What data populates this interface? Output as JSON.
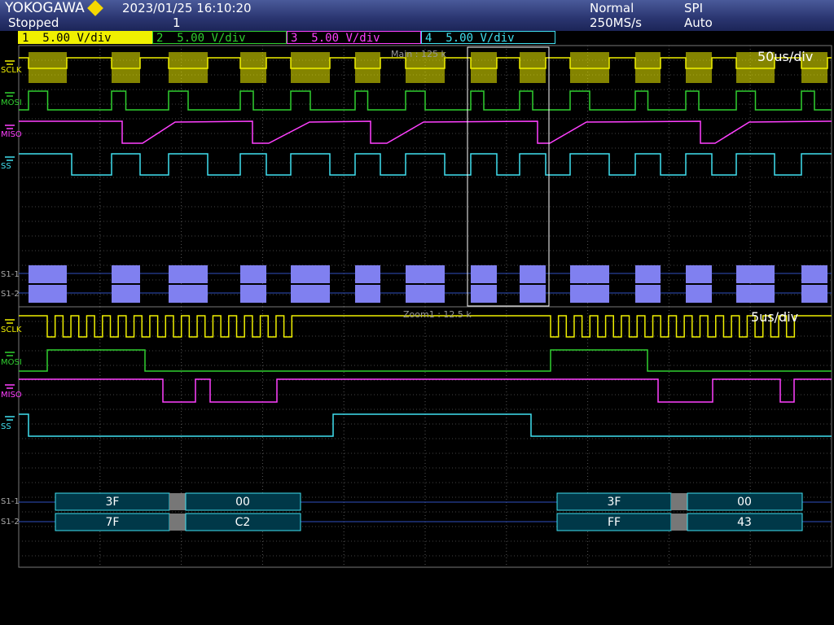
{
  "header": {
    "brand": "YOKOGAWA",
    "status": "Stopped",
    "datetime": "2023/01/25 16:10:20",
    "acq_count": "1",
    "trigger_mode": "Normal",
    "sample_rate": "250MS/s",
    "trigger_type": "SPI",
    "trigger_setting": "Auto"
  },
  "channels": [
    {
      "num": "1",
      "scale": "5.00 V/div",
      "color": "#f0f000"
    },
    {
      "num": "2",
      "scale": "5.00 V/div",
      "color": "#30d030"
    },
    {
      "num": "3",
      "scale": "5.00 V/div",
      "color": "#ff40ff"
    },
    {
      "num": "4",
      "scale": "5.00 V/div",
      "color": "#40e0f0"
    }
  ],
  "main": {
    "window_label": "Main : 125 k",
    "timebase": "50us/div",
    "trace_labels": [
      "SCLK",
      "MOSI",
      "MISO",
      "SS"
    ],
    "bus_labels": [
      "S1-1",
      "S1-2"
    ]
  },
  "zoom": {
    "window_label": "Zoom1 : 12.5 k",
    "timebase": "5us/div",
    "trace_labels": [
      "SCLK",
      "MOSI",
      "MISO",
      "SS"
    ],
    "bus_labels": [
      "S1-1",
      "S1-2"
    ],
    "decode_row1": [
      "3F",
      "00",
      "3F",
      "00"
    ],
    "decode_row2": [
      "7F",
      "C2",
      "FF",
      "43"
    ]
  }
}
